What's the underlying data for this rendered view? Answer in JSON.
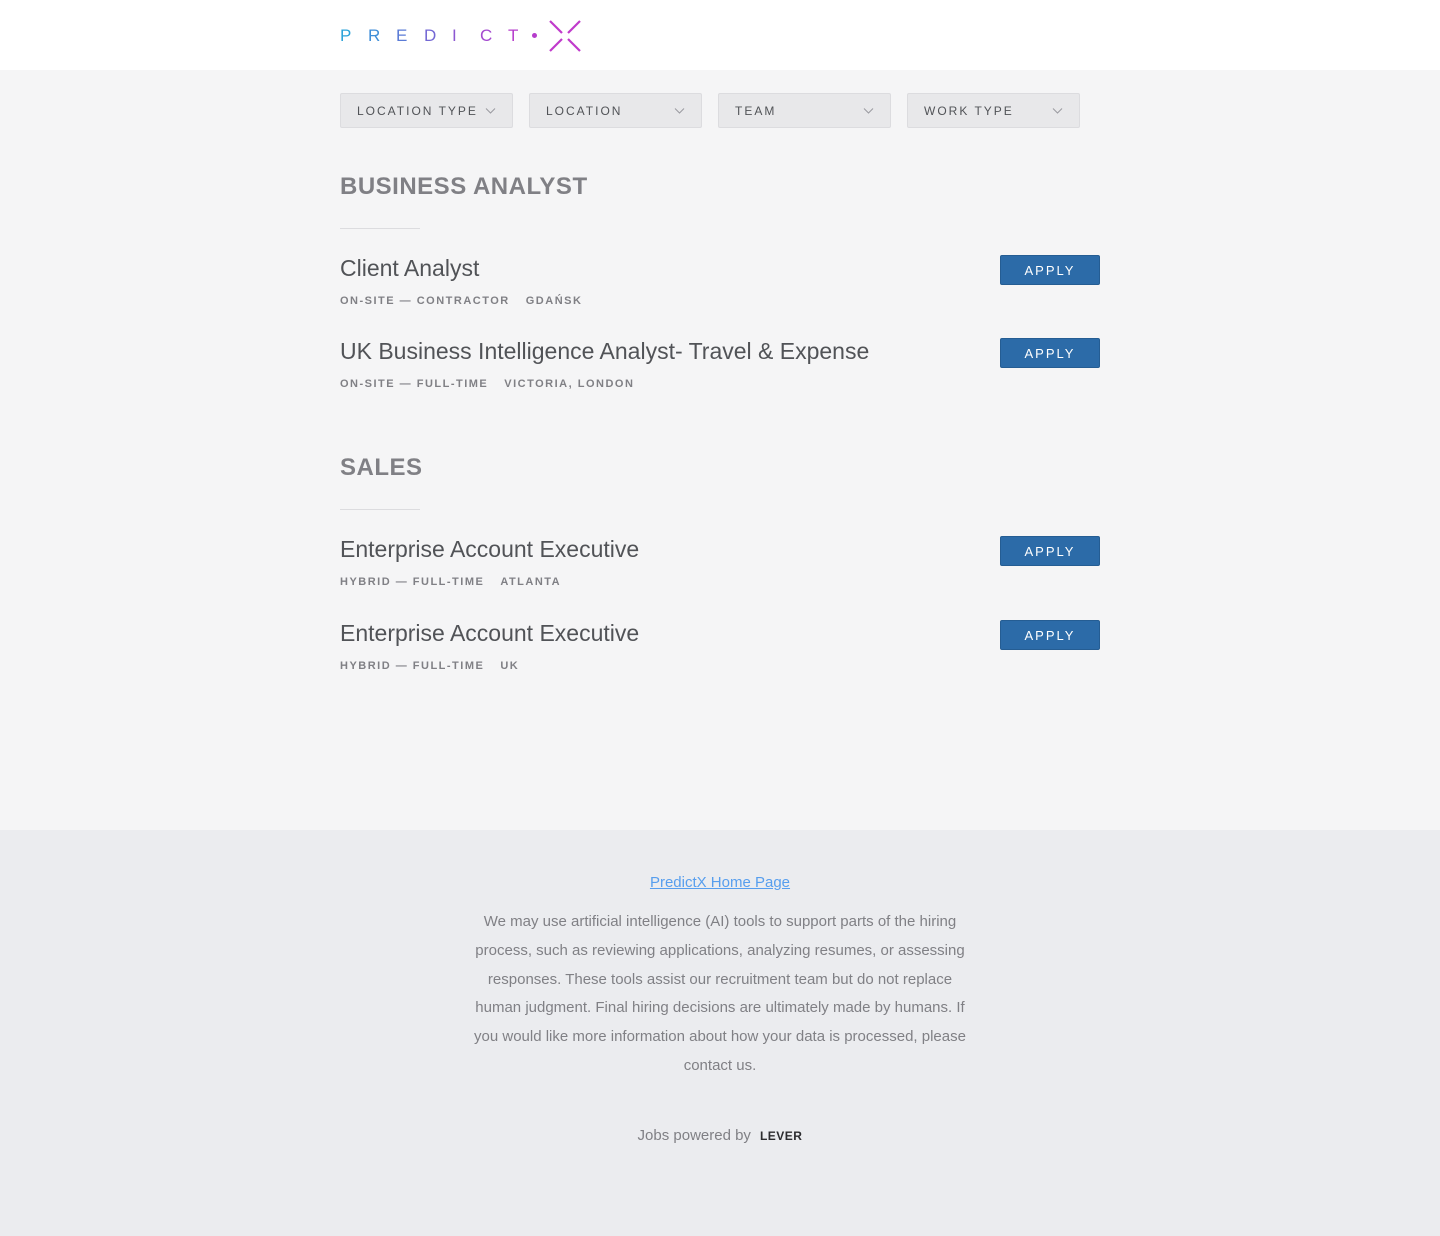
{
  "brand": {
    "logo_letters": [
      "P",
      "R",
      "E",
      "D",
      "I",
      "C",
      "T"
    ],
    "logo_colors": [
      "#2ba3d9",
      "#3f8ed8",
      "#5a7bd6",
      "#7468d4",
      "#8c58d1",
      "#a349cf",
      "#b63dcc"
    ],
    "logo_mark_color": "#c03acb",
    "logo_name": "PredictX"
  },
  "filters": [
    {
      "label": "LOCATION TYPE"
    },
    {
      "label": "LOCATION"
    },
    {
      "label": "TEAM"
    },
    {
      "label": "WORK TYPE"
    }
  ],
  "sections": [
    {
      "title": "BUSINESS ANALYST",
      "postings": [
        {
          "title": "Client Analyst",
          "commitment": "ON-SITE — CONTRACTOR",
          "location": "GDAŃSK",
          "apply_label": "APPLY"
        },
        {
          "title": "UK Business Intelligence Analyst- Travel & Expense",
          "commitment": "ON-SITE — FULL-TIME",
          "location": "VICTORIA, LONDON",
          "apply_label": "APPLY"
        }
      ]
    },
    {
      "title": "SALES",
      "postings": [
        {
          "title": "Enterprise Account Executive",
          "commitment": "HYBRID — FULL-TIME",
          "location": "ATLANTA",
          "apply_label": "APPLY"
        },
        {
          "title": "Enterprise Account Executive",
          "commitment": "HYBRID — FULL-TIME",
          "location": "UK",
          "apply_label": "APPLY"
        }
      ]
    }
  ],
  "footer": {
    "home_link": "PredictX Home Page",
    "disclaimer": "We may use artificial intelligence (AI) tools to support parts of the hiring process, such as reviewing applications, analyzing resumes, or assessing responses. These tools assist our recruitment team but do not replace human judgment. Final hiring decisions are ultimately made by humans. If you would like more information about how your data is processed, please contact us.",
    "powered_by": "Jobs powered by",
    "lever_label": "LEVER"
  },
  "colors": {
    "accent_button": "#2c6ba8",
    "link": "#579eee"
  }
}
